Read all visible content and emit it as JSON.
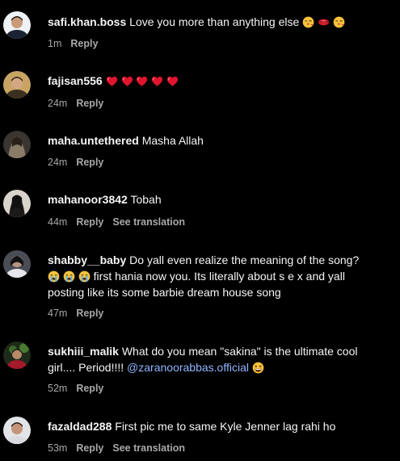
{
  "colors": {
    "background": "#000000",
    "text": "#f5f5f5",
    "meta": "#a8a8a8",
    "mention": "#8fb4ff"
  },
  "comments": [
    {
      "username": "safi.khan.boss",
      "text": "Love you more than anything else",
      "emojis": [
        "kissing-face-emoji",
        "lips-emoji",
        "kissing-face-emoji"
      ],
      "time": "1m",
      "reply": "Reply"
    },
    {
      "username": "fajisan556",
      "emojis": [
        "red-heart-emoji",
        "red-heart-emoji",
        "red-heart-emoji",
        "red-heart-emoji",
        "red-heart-emoji"
      ],
      "time": "24m",
      "reply": "Reply"
    },
    {
      "username": "maha.untethered",
      "text": "Masha Allah",
      "time": "24m",
      "reply": "Reply"
    },
    {
      "username": "mahanoor3842",
      "text": "Tobah",
      "time": "44m",
      "reply": "Reply",
      "translation": "See translation"
    },
    {
      "username": "shabby__baby",
      "text_line1": "Do yall even realize the meaning of the song?",
      "emojis": [
        "crying-face-emoji",
        "crying-face-emoji",
        "crying-face-emoji"
      ],
      "text_line2": "first hania now you. Its literally about s e x and yall",
      "text_line3": "posting like its some barbie dream house song",
      "time": "47m",
      "reply": "Reply"
    },
    {
      "username": "sukhiii_malik",
      "text_line1": "What do you mean \"sakina\" is the ultimate cool",
      "text_line2": "girl.... Period!!!!",
      "mention": "@zaranoorabbas.official",
      "emojis": [
        "grinning-squinting-face-emoji"
      ],
      "time": "52m",
      "reply": "Reply"
    },
    {
      "username": "fazaldad288",
      "text": "First pic me to same Kyle Jenner lag rahi ho",
      "time": "53m",
      "reply": "Reply",
      "translation": "See translation"
    }
  ]
}
